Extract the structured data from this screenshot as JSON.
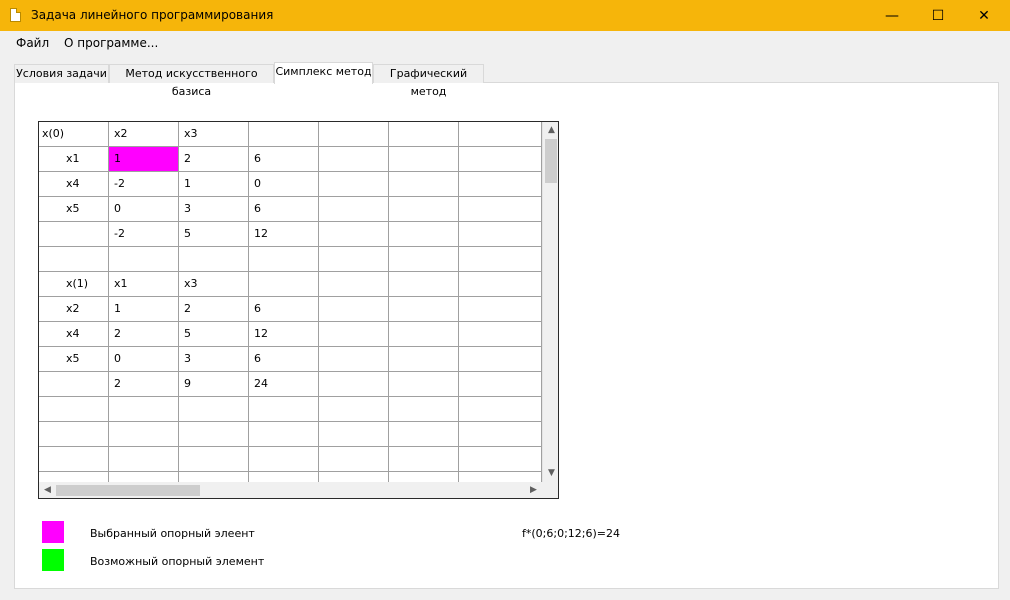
{
  "window": {
    "title": "Задача линейного программирования",
    "controls": {
      "minimize": "—",
      "maximize": "☐",
      "close": "✕"
    }
  },
  "menu": [
    "Файл",
    "О программе..."
  ],
  "tabs": [
    {
      "label": "Условия задачи",
      "active": false
    },
    {
      "label": "Метод искусственного базиса",
      "active": false
    },
    {
      "label": "Симплекс метод",
      "active": true
    },
    {
      "label": "Графический метод",
      "active": false
    }
  ],
  "table": {
    "selected_cell": {
      "row": 1,
      "col": 1
    },
    "rows": [
      [
        "x(0)",
        "x2",
        "x3",
        "",
        "",
        "",
        ""
      ],
      [
        "x1",
        "1",
        "2",
        "6",
        "",
        "",
        ""
      ],
      [
        "x4",
        "-2",
        "1",
        "0",
        "",
        "",
        ""
      ],
      [
        "x5",
        "0",
        "3",
        "6",
        "",
        "",
        ""
      ],
      [
        "",
        "-2",
        "5",
        "12",
        "",
        "",
        ""
      ],
      [
        "",
        "",
        "",
        "",
        "",
        "",
        ""
      ],
      [
        "x(1)",
        "x1",
        "x3",
        "",
        "",
        "",
        ""
      ],
      [
        "x2",
        "1",
        "2",
        "6",
        "",
        "",
        ""
      ],
      [
        "x4",
        "2",
        "5",
        "12",
        "",
        "",
        ""
      ],
      [
        "x5",
        "0",
        "3",
        "6",
        "",
        "",
        ""
      ],
      [
        "",
        "2",
        "9",
        "24",
        "",
        "",
        ""
      ],
      [
        "",
        "",
        "",
        "",
        "",
        "",
        ""
      ],
      [
        "",
        "",
        "",
        "",
        "",
        "",
        ""
      ],
      [
        "",
        "",
        "",
        "",
        "",
        "",
        ""
      ],
      [
        "",
        "",
        "",
        "",
        "",
        "",
        ""
      ]
    ]
  },
  "legend": [
    {
      "label": "Выбранный опорный элеент",
      "color": "#ff00ff"
    },
    {
      "label": "Возможный опорный элемент",
      "color": "#00ff00"
    }
  ],
  "result": "f*(0;6;0;12;6)=24",
  "colors": {
    "titlebar": "#f6b50a",
    "selected": "#ff00ff",
    "possible": "#00ff00"
  }
}
